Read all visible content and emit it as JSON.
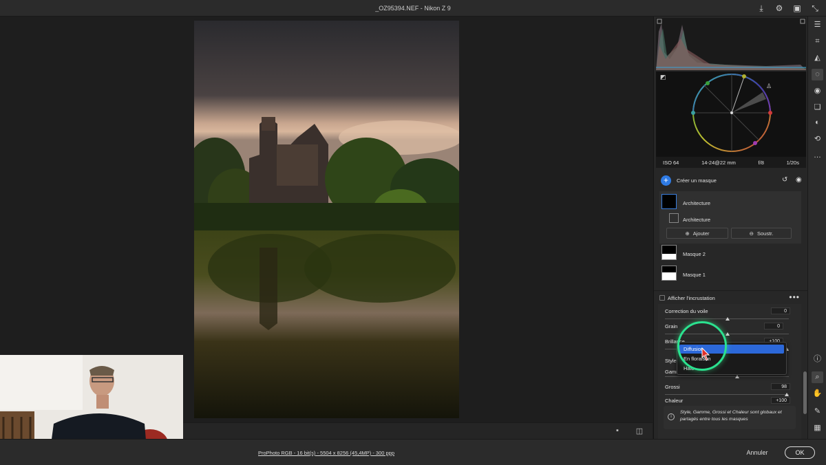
{
  "window": {
    "title": "_OZ95394.NEF  -  Nikon Z 9",
    "icons": [
      "download-icon",
      "gear-icon",
      "present-icon",
      "collapse-icon"
    ]
  },
  "exif": {
    "iso": "ISO 64",
    "lens": "14-24@22 mm",
    "aperture": "f/8",
    "shutter": "1/20s"
  },
  "masks": {
    "create_label": "Créer un masque",
    "items": [
      {
        "label": "Architecture"
      },
      {
        "label": "Architecture"
      },
      {
        "label": "Masque 2"
      },
      {
        "label": "Masque 1"
      }
    ],
    "add_label": "Ajouter",
    "subtract_label": "Soustr."
  },
  "overlay": {
    "label": "Afficher l'incrustation"
  },
  "sliders": {
    "haze": {
      "label": "Correction du voile",
      "value": "0"
    },
    "grain": {
      "label": "Grain",
      "value": "0"
    },
    "bloom": {
      "label": "Brillance",
      "value": "+100"
    },
    "style_label": "Style",
    "gamma_label": "Gamm",
    "size": {
      "label": "Grossi",
      "value": "98"
    },
    "warmth": {
      "label": "Chaleur",
      "value": "+100"
    }
  },
  "dropdown": {
    "items": [
      "Diffusion",
      "En floraison",
      "Halo"
    ],
    "selected": "Diffusion"
  },
  "info": {
    "text": "Style, Gamme, Grossi et Chaleur sont globaux et partagés entre tous les masques"
  },
  "footer": {
    "file_info": "ProPhoto RGB - 16 bit(s) - 5504 x 8256 (45,4MP) - 300 ppp",
    "cancel": "Annuler",
    "ok": "OK"
  },
  "right_tools": [
    "sliders-icon",
    "crop-icon",
    "eraser-icon",
    "mask-icon",
    "redeye-icon",
    "layers-icon",
    "presets-icon",
    "sync-icon",
    "more-icon",
    "info-icon",
    "zoom-icon",
    "hand-icon",
    "eyedropper-icon",
    "grid-icon"
  ]
}
